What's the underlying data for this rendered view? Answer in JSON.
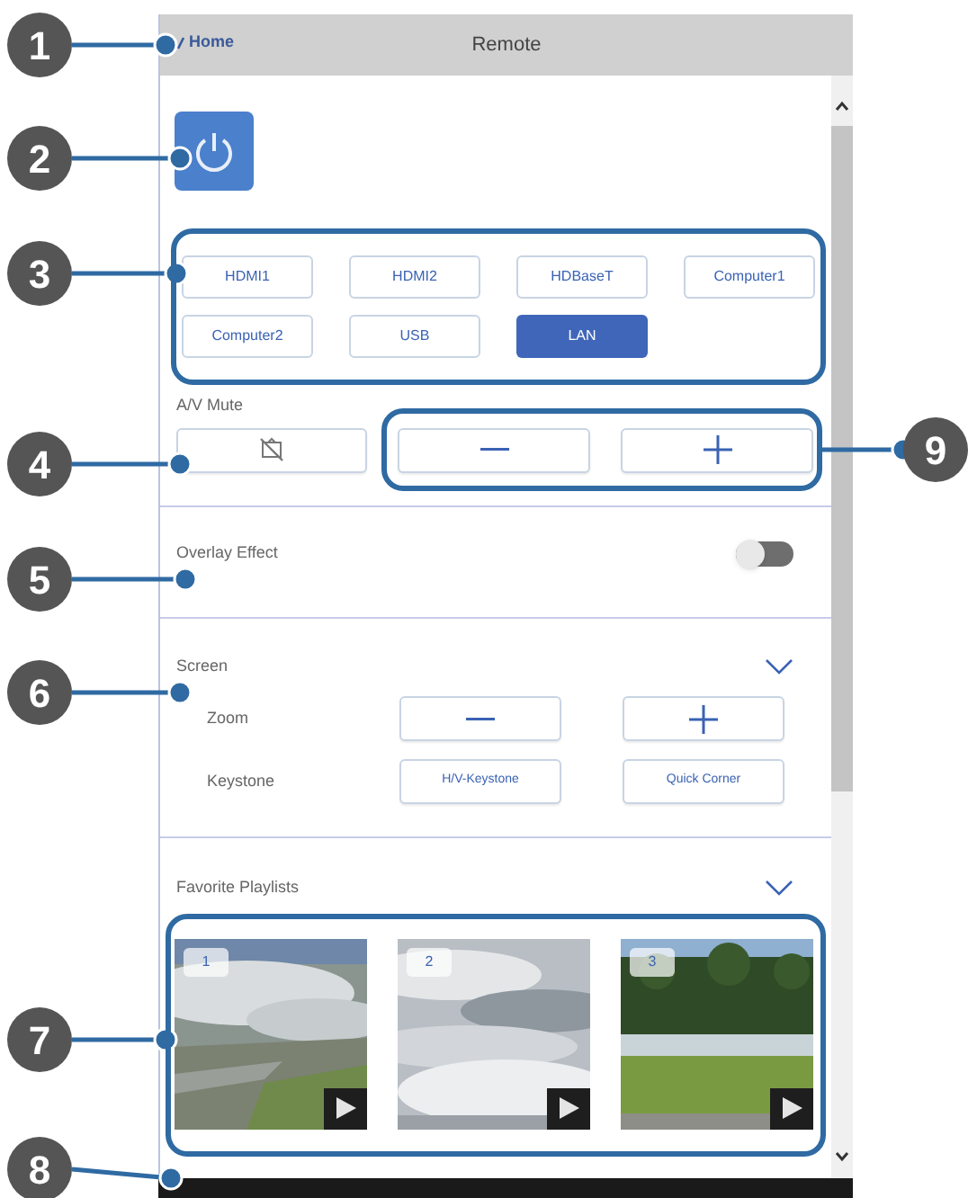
{
  "window": {
    "title": "Remote",
    "back_link": "Home"
  },
  "sources": [
    {
      "label": "HDMI1",
      "selected": false
    },
    {
      "label": "HDMI2",
      "selected": false
    },
    {
      "label": "HDBaseT",
      "selected": false
    },
    {
      "label": "Computer1",
      "selected": false
    },
    {
      "label": "Computer2",
      "selected": false
    },
    {
      "label": "USB",
      "selected": false
    },
    {
      "label": "LAN",
      "selected": true
    }
  ],
  "av_mute": {
    "label": "A/V Mute"
  },
  "overlay_effect": {
    "label": "Overlay Effect",
    "on": false
  },
  "screen": {
    "title": "Screen",
    "rows": [
      {
        "label": "Zoom",
        "kind": "stepper"
      },
      {
        "label": "Keystone",
        "kind": "buttons",
        "buttons": [
          "H/V-Keystone",
          "Quick Corner"
        ]
      }
    ]
  },
  "favorite_playlists": {
    "title": "Favorite Playlists",
    "items": [
      {
        "number": "1",
        "kind": "picture"
      },
      {
        "number": "2",
        "kind": "picture"
      },
      {
        "number": "3",
        "kind": "picture"
      }
    ]
  },
  "callouts": [
    "1",
    "2",
    "3",
    "4",
    "5",
    "6",
    "7",
    "8",
    "9"
  ]
}
